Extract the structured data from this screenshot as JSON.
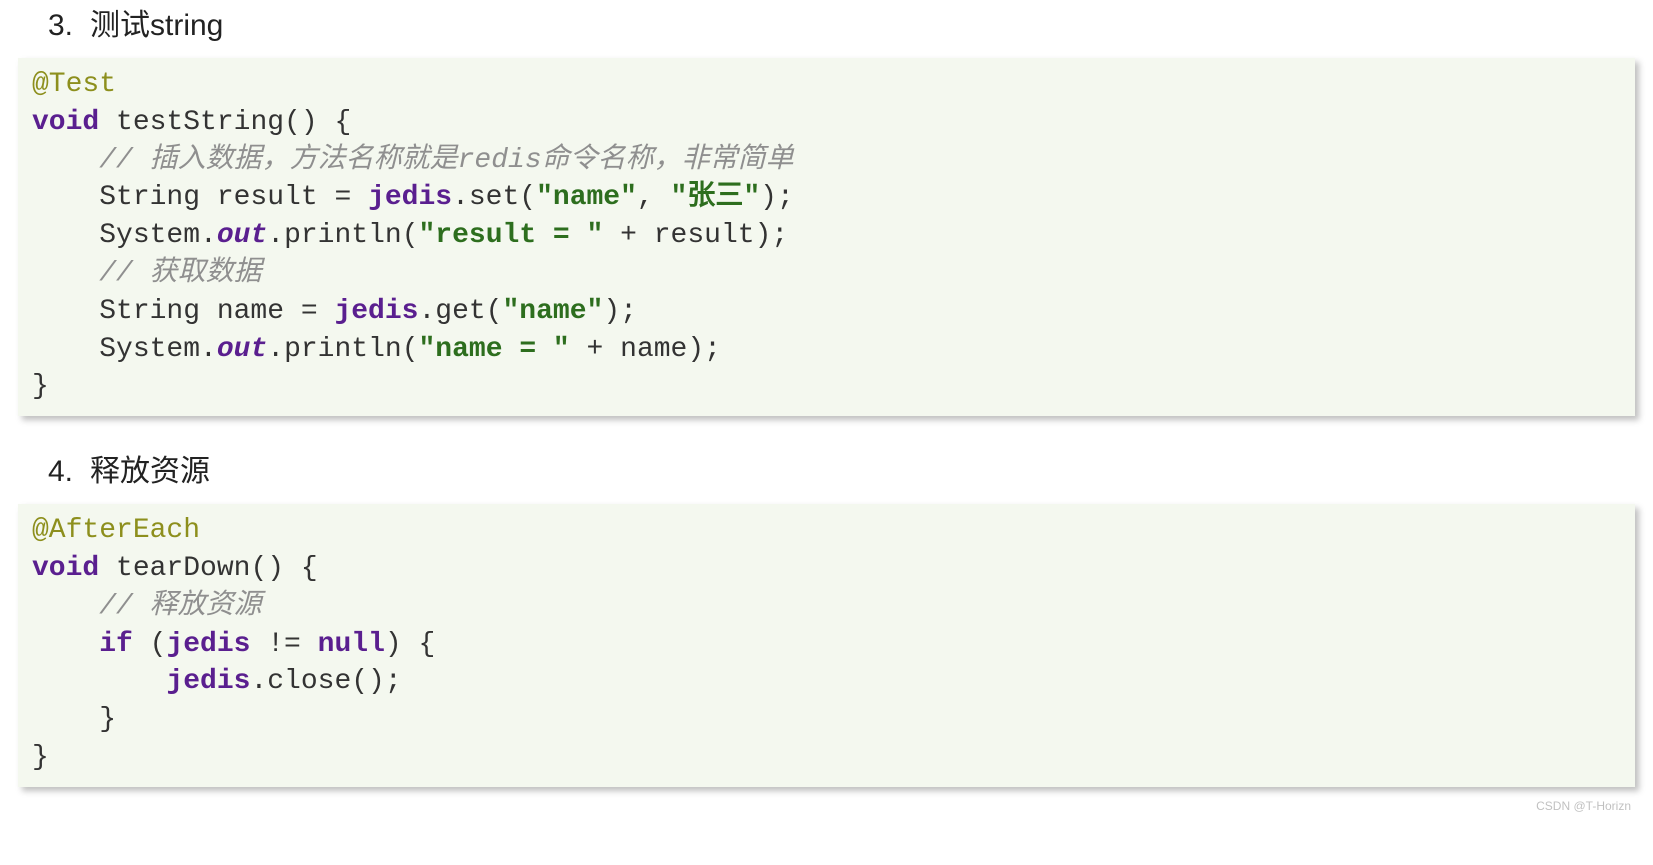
{
  "sections": [
    {
      "number": "3.",
      "title": "测试string",
      "code": {
        "line1_annotation": "@Test",
        "line2_kw": "void",
        "line2_rest": " testString() {",
        "line3_cmt": "    // 插入数据，方法名称就是redis命令名称，非常简单",
        "line4_a": "    String result = ",
        "line4_jedis": "jedis",
        "line4_b": ".set(",
        "line4_str1": "\"name\"",
        "line4_c": ", ",
        "line4_str2": "\"张三\"",
        "line4_d": ");",
        "line5_a": "    System.",
        "line5_out": "out",
        "line5_b": ".println(",
        "line5_str": "\"result = \"",
        "line5_c": " + result);",
        "line6_cmt": "    // 获取数据",
        "line7_a": "    String name = ",
        "line7_jedis": "jedis",
        "line7_b": ".get(",
        "line7_str": "\"name\"",
        "line7_c": ");",
        "line8_a": "    System.",
        "line8_out": "out",
        "line8_b": ".println(",
        "line8_str": "\"name = \"",
        "line8_c": " + name);",
        "line9": "}"
      }
    },
    {
      "number": "4.",
      "title": "释放资源",
      "code": {
        "line1_annotation": "@AfterEach",
        "line2_kw": "void",
        "line2_rest": " tearDown() {",
        "line3_cmt": "    // 释放资源",
        "line4_a": "    ",
        "line4_if": "if",
        "line4_b": " (",
        "line4_jedis": "jedis",
        "line4_c": " != ",
        "line4_null": "null",
        "line4_d": ") {",
        "line5_a": "        ",
        "line5_jedis": "jedis",
        "line5_b": ".close();",
        "line6": "    }",
        "line7": "}"
      }
    }
  ],
  "watermark": "CSDN @T-Horizn"
}
